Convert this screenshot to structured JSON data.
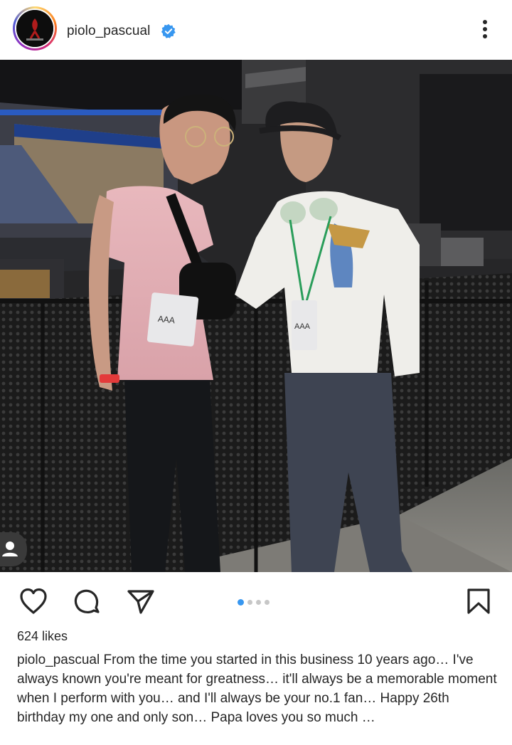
{
  "post": {
    "username": "piolo_pascual",
    "verified": true,
    "likes_text": "624 likes",
    "caption_username": "piolo_pascual",
    "caption_text": " From the time you started in this business 10 years ago… I've always known you're meant for greatness… it'll always be a memorable  moment when I perform with you…  and I'll always be your no.1 fan…  Happy 26th birthday my one and only son… Papa loves you so much …",
    "carousel": {
      "total": 4,
      "current": 1
    },
    "badges": [
      "AAA",
      "AAA"
    ]
  },
  "icons": {
    "avatar": "profile-avatar",
    "verified": "verified-badge-icon",
    "more": "more-options-icon",
    "like": "heart-icon",
    "comment": "comment-icon",
    "share": "paper-plane-icon",
    "save": "bookmark-icon",
    "tag": "user-tag-icon"
  },
  "colors": {
    "accent": "#3897f0",
    "verified": "#3897f0",
    "text": "#262626"
  }
}
